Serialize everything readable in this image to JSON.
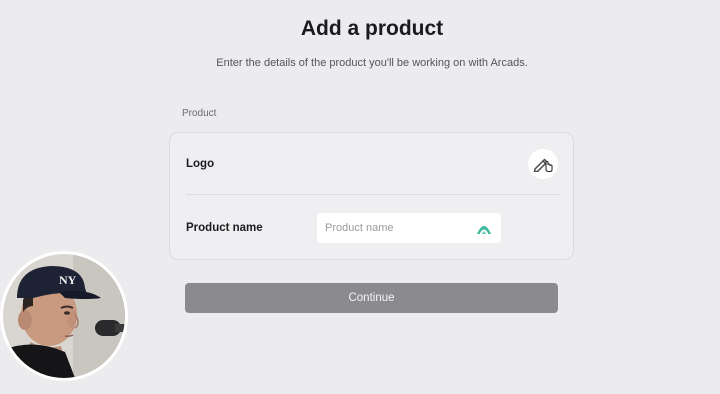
{
  "page": {
    "title": "Add a product",
    "subtitle": "Enter the details of the product you'll be working on with Arcads."
  },
  "form": {
    "section_label": "Product",
    "logo": {
      "label": "Logo",
      "upload_icon": "pen-hand-cursor-icon"
    },
    "product_name": {
      "label": "Product name",
      "placeholder": "Product name",
      "value": "",
      "extension_icon": "autofill-extension-icon",
      "extension_color": "#3fb8a1"
    },
    "continue_label": "Continue"
  },
  "overlay": {
    "webcam_icon": "webcam-presenter"
  },
  "colors": {
    "background": "#ececee",
    "card": "#efeff1",
    "button_disabled": "#8b8b8e",
    "accent": "#3fb8a1"
  }
}
